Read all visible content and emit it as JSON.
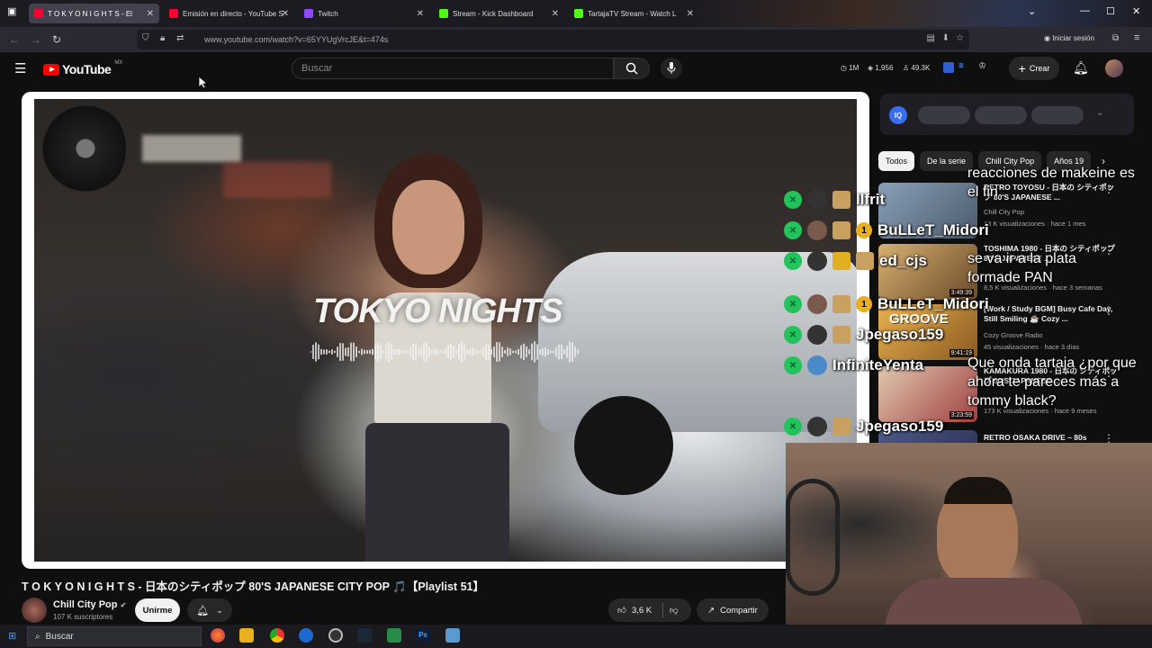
{
  "browser": {
    "tabs": [
      {
        "label": "T O K Y O   N I G H T S - El",
        "color": "#ff0033",
        "active": true
      },
      {
        "label": "Emisión en directo - YouTube S",
        "color": "#ff0033",
        "active": false
      },
      {
        "label": "Twitch",
        "color": "#9146ff",
        "active": false
      },
      {
        "label": "Stream - Kick Dashboard",
        "color": "#53fc18",
        "active": false
      },
      {
        "label": "TartajaTV Stream - Watch L",
        "color": "#53fc18",
        "active": false
      }
    ],
    "url": "www.youtube.com/watch?v=65YYUgVrcJE&t=474s",
    "signin_label": "Iniciar sesión"
  },
  "youtube": {
    "logo_text": "YouTube",
    "country_code": "MX",
    "search_placeholder": "Buscar",
    "stats": {
      "viewers": "1M",
      "count": "1,956",
      "subs": "49.3K"
    },
    "create_label": "Crear"
  },
  "video": {
    "overlay_title": "TOKYO NIGHTS",
    "title": "T O K Y O   N I G H T S - 日本のシティポップ 80'S JAPANESE CITY POP 🎵【Playlist 51】",
    "channel": "Chill City Pop",
    "subscribers": "107 K suscriptores",
    "join_label": "Unirme",
    "likes": "3,6 K",
    "share_label": "Compartir"
  },
  "chips": [
    "Todos",
    "De la serie",
    "Chill City Pop",
    "Años 19"
  ],
  "recommendations": [
    {
      "title": "RETRO TOYOSU - 日本の シティポップ 80'S JAPANESE ...",
      "channel": "Chill City Pop",
      "meta": "13 K visualizaciones · hace 1 mes",
      "duration": "",
      "thumb": "#5a6a7a"
    },
    {
      "title": "TOSHIMA 1980 - 日本の シティポップ 80'S JAPANESE ...",
      "channel": "",
      "meta": "8,5 K visualizaciones · hace 3 semanas",
      "duration": "3:49:39",
      "thumb": "#8a6a3a"
    },
    {
      "title": "[Work / Study BGM] Busy Cafe Day, Still Smiling ☕ Cozy ...",
      "channel": "Cozy Groove Radio",
      "meta": "45 visualizaciones · hace 3 días",
      "duration": "9:41:19",
      "thumb": "#c89040"
    },
    {
      "title": "KAMAKURA 1980 - 日本の シティポップ 80'S JAPANESE ...",
      "channel": "",
      "meta": "173 K visualizaciones · hace 9 meses",
      "duration": "3:23:59",
      "thumb": "#a05050"
    },
    {
      "title": "RETRO OSAKA DRIVE – 80s",
      "channel": "",
      "meta": "",
      "duration": "",
      "thumb": "#3a4a6a"
    }
  ],
  "chat": {
    "rows": [
      {
        "name": "Ilfrit",
        "badge_icon": "kick-icon",
        "avatar": "#333",
        "icon": "#c8a060",
        "sub": ""
      },
      {
        "name": "BuLLeT_Midori",
        "badge_icon": "kick-icon",
        "avatar": "#7a5a4a",
        "icon": "#c8a060",
        "sub": "1"
      },
      {
        "name": "ed_cjs",
        "badge_icon": "kick-icon",
        "avatar": "#333",
        "icon": "#e0b020",
        "sub": ""
      },
      {
        "name": "BuLLeT_Midori",
        "badge_icon": "kick-icon",
        "avatar": "#7a5a4a",
        "icon": "#c8a060",
        "sub": "1"
      },
      {
        "name": "Jpegaso159",
        "badge_icon": "kick-icon",
        "avatar": "#333",
        "icon": "#c8a060",
        "sub": ""
      },
      {
        "name": "InfiniteYenta",
        "badge_icon": "kick-icon",
        "avatar": "#4a8ac8",
        "icon": "",
        "sub": ""
      },
      {
        "name": "Jpegaso159",
        "badge_icon": "kick-icon",
        "avatar": "#333",
        "icon": "#c8a060",
        "sub": ""
      }
    ],
    "messages": [
      "reacciones de makeine es el fin",
      "se va ir a la plata formade PAN",
      "Que onda tartaja ¿por que ahora te pareces más a tommy black?"
    ]
  },
  "taskbar": {
    "search_placeholder": "Buscar"
  }
}
